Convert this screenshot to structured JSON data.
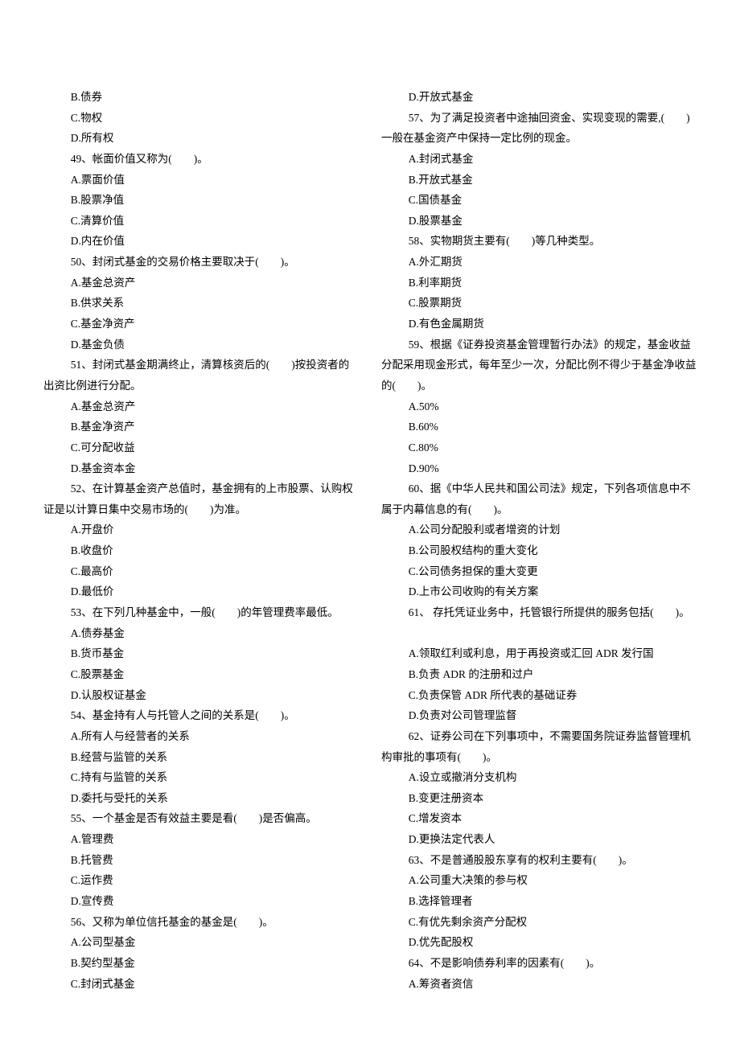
{
  "lines": [
    {
      "text": "B.债券",
      "indent": true
    },
    {
      "text": "C.物权",
      "indent": true
    },
    {
      "text": "D.所有权",
      "indent": true
    },
    {
      "text": "49、帐面价值又称为(　　)。",
      "indent": true
    },
    {
      "text": "A.票面价值",
      "indent": true
    },
    {
      "text": "B.股票净值",
      "indent": true
    },
    {
      "text": "C.清算价值",
      "indent": true
    },
    {
      "text": "D.内在价值",
      "indent": true
    },
    {
      "text": "50、封闭式基金的交易价格主要取决于(　　)。",
      "indent": true
    },
    {
      "text": "A.基金总资产",
      "indent": true
    },
    {
      "text": "B.供求关系",
      "indent": true
    },
    {
      "text": "C.基金净资产",
      "indent": true
    },
    {
      "text": "D.基金负债",
      "indent": true
    },
    {
      "text": "51、封闭式基金期满终止，清算核资后的(　　)按投资者的出资比例进行分配。",
      "indent": true
    },
    {
      "text": "A.基金总资产",
      "indent": true
    },
    {
      "text": "B.基金净资产",
      "indent": true
    },
    {
      "text": "C.可分配收益",
      "indent": true
    },
    {
      "text": "D.基金资本金",
      "indent": true
    },
    {
      "text": "52、在计算基金资产总值时，基金拥有的上市股票、认购权证是以计算日集中交易市场的(　　)为准。",
      "indent": true
    },
    {
      "text": "A.开盘价",
      "indent": true
    },
    {
      "text": "B.收盘价",
      "indent": true
    },
    {
      "text": "C.最高价",
      "indent": true
    },
    {
      "text": "D.最低价",
      "indent": true
    },
    {
      "text": "53、在下列几种基金中，一般(　　)的年管理费率最低。",
      "indent": true
    },
    {
      "text": "A.债券基金",
      "indent": true
    },
    {
      "text": "B.货币基金",
      "indent": true
    },
    {
      "text": "C.股票基金",
      "indent": true
    },
    {
      "text": "D.认股权证基金",
      "indent": true
    },
    {
      "text": "54、基金持有人与托管人之间的关系是(　　)。",
      "indent": true
    },
    {
      "text": "A.所有人与经营者的关系",
      "indent": true
    },
    {
      "text": "B.经营与监管的关系",
      "indent": true
    },
    {
      "text": "C.持有与监管的关系",
      "indent": true
    },
    {
      "text": "D.委托与受托的关系",
      "indent": true
    },
    {
      "text": "55、一个基金是否有效益主要是看(　　)是否偏高。",
      "indent": true
    },
    {
      "text": "A.管理费",
      "indent": true
    },
    {
      "text": "B.托管费",
      "indent": true
    },
    {
      "text": "C.运作费",
      "indent": true
    },
    {
      "text": "D.宣传费",
      "indent": true
    },
    {
      "text": "56、又称为单位信托基金的基金是(　　)。",
      "indent": true
    },
    {
      "text": "A.公司型基金",
      "indent": true
    },
    {
      "text": "B.契约型基金",
      "indent": true
    },
    {
      "text": "C.封闭式基金",
      "indent": true
    },
    {
      "text": "D.开放式基金",
      "indent": true
    },
    {
      "text": "57、为了满足投资者中途抽回资金、实现变现的需要,(　　)一般在基金资产中保持一定比例的现金。",
      "indent": true
    },
    {
      "text": "A.封闭式基金",
      "indent": true
    },
    {
      "text": "B.开放式基金",
      "indent": true
    },
    {
      "text": "C.国债基金",
      "indent": true
    },
    {
      "text": "D.股票基金",
      "indent": true
    },
    {
      "text": "58、实物期货主要有(　　)等几种类型。",
      "indent": true
    },
    {
      "text": "A.外汇期货",
      "indent": true
    },
    {
      "text": "B.利率期货",
      "indent": true
    },
    {
      "text": "C.股票期货",
      "indent": true
    },
    {
      "text": "D.有色金属期货",
      "indent": true
    },
    {
      "text": "59、根据《证券投资基金管理暂行办法》的规定，基金收益分配采用现金形式，每年至少一次，分配比例不得少于基金净收益的(　　)。",
      "indent": true
    },
    {
      "text": "A.50%",
      "indent": true
    },
    {
      "text": "B.60%",
      "indent": true
    },
    {
      "text": "C.80%",
      "indent": true
    },
    {
      "text": "D.90%",
      "indent": true
    },
    {
      "text": "60、据《中华人民共和国公司法》规定，下列各项信息中不属于内幕信息的有(　　)。",
      "indent": true
    },
    {
      "text": "A.公司分配股利或者增资的计划",
      "indent": true
    },
    {
      "text": "B.公司股权结构的重大变化",
      "indent": true
    },
    {
      "text": "C.公司债务担保的重大变更",
      "indent": true
    },
    {
      "text": "D.上市公司收购的有关方案",
      "indent": true
    },
    {
      "text": "61、 存托凭证业务中，托管银行所提供的服务包括(　　)。",
      "indent": true
    },
    {
      "text": " ",
      "indent": true
    },
    {
      "text": "A.领取红利或利息，用于再投资或汇回 ADR 发行国",
      "indent": true
    },
    {
      "text": "B.负责 ADR 的注册和过户",
      "indent": true
    },
    {
      "text": "C.负责保管 ADR 所代表的基础证券",
      "indent": true
    },
    {
      "text": "D.负责对公司管理监督",
      "indent": true
    },
    {
      "text": "62、证券公司在下列事项中，不需要国务院证券监督管理机构审批的事项有(　　)。",
      "indent": true
    },
    {
      "text": "A.设立或撤消分支机构",
      "indent": true
    },
    {
      "text": "B.变更注册资本",
      "indent": true
    },
    {
      "text": "C.增发资本",
      "indent": true
    },
    {
      "text": "D.更换法定代表人",
      "indent": true
    },
    {
      "text": "63、不是普通股股东享有的权利主要有(　　)。",
      "indent": true
    },
    {
      "text": "A.公司重大决策的参与权",
      "indent": true
    },
    {
      "text": "B.选择管理者",
      "indent": true
    },
    {
      "text": "C.有优先剩余资产分配权",
      "indent": true
    },
    {
      "text": "D.优先配股权",
      "indent": true
    },
    {
      "text": "64、不是影响债券利率的因素有(　　)。",
      "indent": true
    },
    {
      "text": "A.筹资者资信",
      "indent": true
    }
  ]
}
